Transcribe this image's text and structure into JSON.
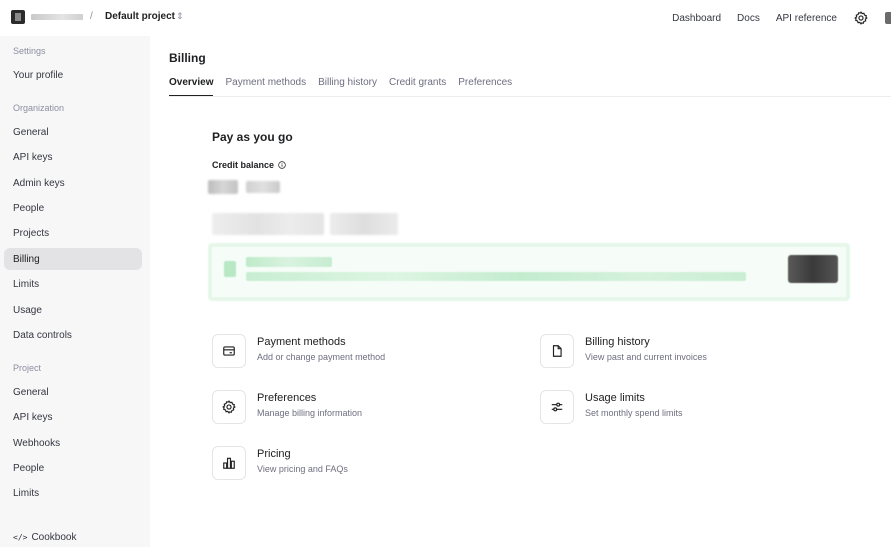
{
  "topbar": {
    "separator": "/",
    "project_name": "Default project",
    "project_chevron": "⇕",
    "links": [
      "Dashboard",
      "Docs",
      "API reference"
    ]
  },
  "sidebar": {
    "sections": [
      {
        "title": "Settings",
        "items": [
          "Your profile"
        ]
      },
      {
        "title": "Organization",
        "items": [
          "General",
          "API keys",
          "Admin keys",
          "People",
          "Projects",
          "Billing",
          "Limits",
          "Usage",
          "Data controls"
        ]
      },
      {
        "title": "Project",
        "items": [
          "General",
          "API keys",
          "Webhooks",
          "People",
          "Limits"
        ]
      }
    ],
    "active_item": "Billing",
    "cookbook_icon": "</>",
    "cookbook_label": "Cookbook"
  },
  "main": {
    "title": "Billing",
    "tabs": [
      "Overview",
      "Payment methods",
      "Billing history",
      "Credit grants",
      "Preferences"
    ],
    "active_tab": "Overview",
    "section_title": "Pay as you go",
    "credit_label": "Credit balance",
    "cards": [
      {
        "icon": "credit-card-icon",
        "title": "Payment methods",
        "desc": "Add or change payment method"
      },
      {
        "icon": "document-icon",
        "title": "Billing history",
        "desc": "View past and current invoices"
      },
      {
        "icon": "gear-icon",
        "title": "Preferences",
        "desc": "Manage billing information"
      },
      {
        "icon": "sliders-icon",
        "title": "Usage limits",
        "desc": "Set monthly spend limits"
      },
      {
        "icon": "pricing-chart-icon",
        "title": "Pricing",
        "desc": "View pricing and FAQs"
      }
    ]
  }
}
